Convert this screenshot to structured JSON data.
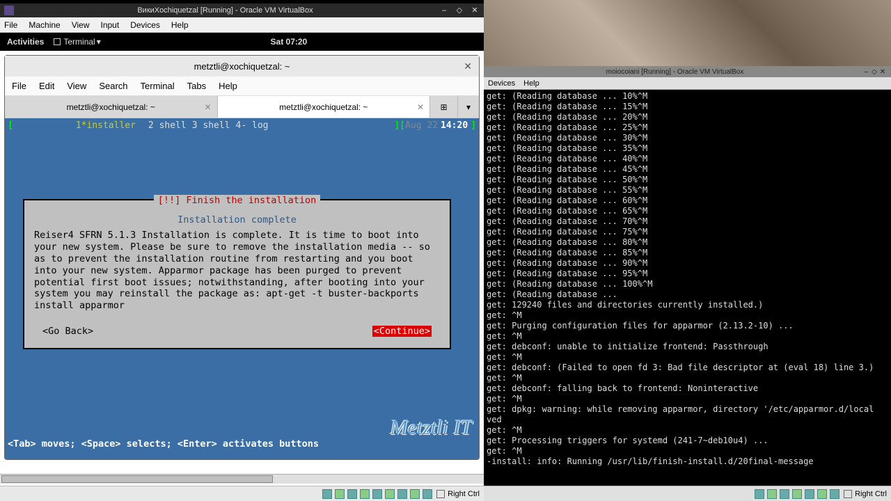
{
  "vm_left": {
    "title": "ВикиXochiquetzal [Running] - Oracle VM VirtualBox",
    "menu": [
      "File",
      "Machine",
      "View",
      "Input",
      "Devices",
      "Help"
    ],
    "host_key": "Right Ctrl"
  },
  "gnome": {
    "activities": "Activities",
    "terminal": "Terminal",
    "clock": "Sat 07:20"
  },
  "term": {
    "title": "metztli@xochiquetzal: ~",
    "menu": [
      "File",
      "Edit",
      "View",
      "Search",
      "Terminal",
      "Tabs",
      "Help"
    ],
    "tabs": [
      "metztli@xochiquetzal: ~",
      "metztli@xochiquetzal: ~"
    ],
    "status_items": [
      "1*installer",
      "2 shell",
      "3 shell",
      "4- log"
    ],
    "status_date": "Aug 22",
    "status_time": "14:20",
    "help_line": "<Tab> moves; <Space> selects; <Enter> activates buttons"
  },
  "installer": {
    "box_title": "[!!] Finish the installation",
    "subtitle": "Installation complete",
    "body": "Reiser4 SFRN 5.1.3 Installation is complete. It is time to boot into your new system. Please be sure to remove the installation media -- so as to prevent  the installation routine from restarting and you boot into your new system. Apparmor package has been purged to prevent potential first boot issues; notwithstanding, after booting into your system you may reinstall the package as: apt-get -t buster-backports install apparmor",
    "go_back": "<Go Back>",
    "continue": "<Continue>"
  },
  "watermark": "Metztli IT",
  "vm_right": {
    "title": "moiocoiani [Running] - Oracle VM VirtualBox",
    "menu": [
      "Devices",
      "Help"
    ],
    "host_key": "Right Ctrl",
    "log_lines": [
      "get: (Reading database ... 10%^M",
      "get: (Reading database ... 15%^M",
      "get: (Reading database ... 20%^M",
      "get: (Reading database ... 25%^M",
      "get: (Reading database ... 30%^M",
      "get: (Reading database ... 35%^M",
      "get: (Reading database ... 40%^M",
      "get: (Reading database ... 45%^M",
      "get: (Reading database ... 50%^M",
      "get: (Reading database ... 55%^M",
      "get: (Reading database ... 60%^M",
      "get: (Reading database ... 65%^M",
      "get: (Reading database ... 70%^M",
      "get: (Reading database ... 75%^M",
      "get: (Reading database ... 80%^M",
      "get: (Reading database ... 85%^M",
      "get: (Reading database ... 90%^M",
      "get: (Reading database ... 95%^M",
      "get: (Reading database ... 100%^M",
      "get: (Reading database ...",
      "get: 129240 files and directories currently installed.)",
      "get: ^M",
      "get: Purging configuration files for apparmor (2.13.2-10) ...",
      "get: ^M",
      "get: debconf: unable to initialize frontend: Passthrough",
      "get: ^M",
      "get: debconf: (Failed to open fd 3: Bad file descriptor at (eval 18) line 3.)",
      "get: ^M",
      "get: debconf: falling back to frontend: Noninteractive",
      "get: ^M",
      "get: dpkg: warning: while removing apparmor, directory '/etc/apparmor.d/local",
      "ved",
      "get: ^M",
      "get: Processing triggers for systemd (241-7~deb10u4) ...",
      "get: ^M",
      "-install: info: Running /usr/lib/finish-install.d/20final-message"
    ]
  }
}
